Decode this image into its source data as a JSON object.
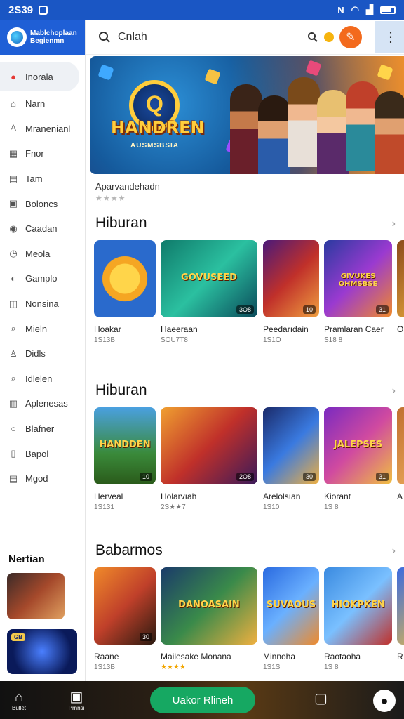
{
  "status": {
    "time": "2S39",
    "icons": [
      "nfc-icon",
      "wifi-icon",
      "signal-icon",
      "battery-icon"
    ]
  },
  "brand": {
    "line1": "Mablchoplaan",
    "line2": "Begienmn"
  },
  "search": {
    "value": "Cnlah"
  },
  "sidebar": {
    "items": [
      {
        "label": "Inorala",
        "icon": "heart-icon",
        "glyph": "●"
      },
      {
        "label": "Narn",
        "icon": "building-icon",
        "glyph": "⌂"
      },
      {
        "label": "Mranenianl",
        "icon": "person-icon",
        "glyph": "♙"
      },
      {
        "label": "Fnor",
        "icon": "calendar-icon",
        "glyph": "▦"
      },
      {
        "label": "Tam",
        "icon": "chart-icon",
        "glyph": "▤"
      },
      {
        "label": "Boloncs",
        "icon": "lock-icon",
        "glyph": "▣"
      },
      {
        "label": "Caadan",
        "icon": "location-icon",
        "glyph": "◉"
      },
      {
        "label": "Meola",
        "icon": "clock-icon",
        "glyph": "◷"
      },
      {
        "label": "Gamplo",
        "icon": "gamepad-icon",
        "glyph": "◐"
      },
      {
        "label": "Nonsina",
        "icon": "bag-icon",
        "glyph": "◫"
      },
      {
        "label": "Mieln",
        "icon": "search-icon",
        "glyph": "⌕"
      },
      {
        "label": "Didls",
        "icon": "user-icon",
        "glyph": "♙"
      },
      {
        "label": "Idlelen",
        "icon": "magnifier-icon",
        "glyph": "⌕"
      },
      {
        "label": "Aplenesas",
        "icon": "store-icon",
        "glyph": "▥"
      },
      {
        "label": "Blafner",
        "icon": "circle-icon",
        "glyph": "○"
      },
      {
        "label": "Bapol",
        "icon": "book-icon",
        "glyph": "▯"
      },
      {
        "label": "Mgod",
        "icon": "list-icon",
        "glyph": "▤"
      }
    ],
    "section_title": "Nertian"
  },
  "hero": {
    "logo": "HANDREN",
    "logo_sub": "AUSMSBSIA",
    "ring_letter": "Q",
    "title": "Aparvandehadn",
    "stars": "★★★★"
  },
  "sections": [
    {
      "title": "Hiburan",
      "cards": [
        {
          "name": "Hoakar",
          "meta": "1S13B",
          "badge": "",
          "art": ""
        },
        {
          "name": "Haeeraan",
          "meta": "SOU7T8",
          "badge": "3O8",
          "art": "GOVUSEED"
        },
        {
          "name": "Peedarıdain",
          "meta": "1S1O",
          "badge": "10",
          "art": ""
        },
        {
          "name": "Pramlaran Caer",
          "meta": "S18 8",
          "badge": "31",
          "art": "GIVUKES OHMSBSE"
        },
        {
          "name": "O",
          "meta": "",
          "badge": "",
          "art": ""
        }
      ]
    },
    {
      "title": "Hiburan",
      "cards": [
        {
          "name": "Herveal",
          "meta": "1S131",
          "badge": "10",
          "art": "HANDDEN"
        },
        {
          "name": "Holarvıah",
          "meta": "2S★★7",
          "badge": "2O8",
          "art": ""
        },
        {
          "name": "Arelolsıan",
          "meta": "1S10",
          "badge": "30",
          "art": ""
        },
        {
          "name": "Kiorant",
          "meta": "1S 8",
          "badge": "31",
          "art": "JALEPSES"
        },
        {
          "name": "A",
          "meta": "",
          "badge": "",
          "art": ""
        }
      ]
    },
    {
      "title": "Babarmos",
      "cards": [
        {
          "name": "Raane",
          "meta": "1S13B",
          "badge": "30",
          "art": ""
        },
        {
          "name": "Mailesake Monana",
          "meta": "★★★★",
          "badge": "",
          "art": "DANOASAIN"
        },
        {
          "name": "Minnoha",
          "meta": "1S1S",
          "badge": "",
          "art": "SUVAOUS"
        },
        {
          "name": "Raotaoha",
          "meta": "1S 8",
          "badge": "",
          "art": "HIOKPKEN"
        },
        {
          "name": "R",
          "meta": "",
          "badge": "",
          "art": ""
        }
      ]
    }
  ],
  "bottom": {
    "home_label": "Bullet",
    "games_label": "Prnnsi",
    "cta_label": "Uakor Rlineh"
  },
  "colors": {
    "brand": "#1f5fd6",
    "accent": "#f36a1d",
    "cta": "#16a862"
  }
}
